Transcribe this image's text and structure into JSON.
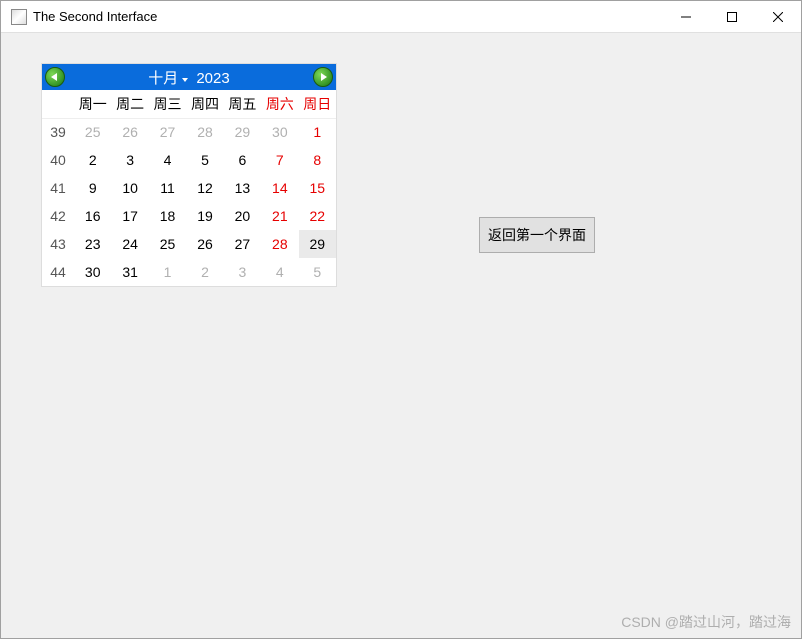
{
  "window": {
    "title": "The Second Interface"
  },
  "calendar": {
    "month_label": "十月",
    "year_label": "2023",
    "day_headers": [
      "周一",
      "周二",
      "周三",
      "周四",
      "周五",
      "周六",
      "周日"
    ],
    "rows": [
      {
        "week": "39",
        "days": [
          {
            "n": "25",
            "other": true
          },
          {
            "n": "26",
            "other": true
          },
          {
            "n": "27",
            "other": true
          },
          {
            "n": "28",
            "other": true
          },
          {
            "n": "29",
            "other": true
          },
          {
            "n": "30",
            "other": true
          },
          {
            "n": "1",
            "weekend": true
          }
        ]
      },
      {
        "week": "40",
        "days": [
          {
            "n": "2"
          },
          {
            "n": "3"
          },
          {
            "n": "4"
          },
          {
            "n": "5"
          },
          {
            "n": "6"
          },
          {
            "n": "7",
            "weekend": true
          },
          {
            "n": "8",
            "weekend": true
          }
        ]
      },
      {
        "week": "41",
        "days": [
          {
            "n": "9"
          },
          {
            "n": "10"
          },
          {
            "n": "11"
          },
          {
            "n": "12"
          },
          {
            "n": "13"
          },
          {
            "n": "14",
            "weekend": true
          },
          {
            "n": "15",
            "weekend": true
          }
        ]
      },
      {
        "week": "42",
        "days": [
          {
            "n": "16"
          },
          {
            "n": "17"
          },
          {
            "n": "18"
          },
          {
            "n": "19"
          },
          {
            "n": "20"
          },
          {
            "n": "21",
            "weekend": true
          },
          {
            "n": "22",
            "weekend": true
          }
        ]
      },
      {
        "week": "43",
        "days": [
          {
            "n": "23"
          },
          {
            "n": "24"
          },
          {
            "n": "25"
          },
          {
            "n": "26"
          },
          {
            "n": "27"
          },
          {
            "n": "28",
            "weekend": true
          },
          {
            "n": "29",
            "selected": true
          }
        ]
      },
      {
        "week": "44",
        "days": [
          {
            "n": "30"
          },
          {
            "n": "31"
          },
          {
            "n": "1",
            "other": true
          },
          {
            "n": "2",
            "other": true
          },
          {
            "n": "3",
            "other": true
          },
          {
            "n": "4",
            "other": true
          },
          {
            "n": "5",
            "other": true
          }
        ]
      }
    ]
  },
  "buttons": {
    "return_label": "返回第一个界面"
  },
  "watermark": "CSDN @踏过山河，踏过海"
}
